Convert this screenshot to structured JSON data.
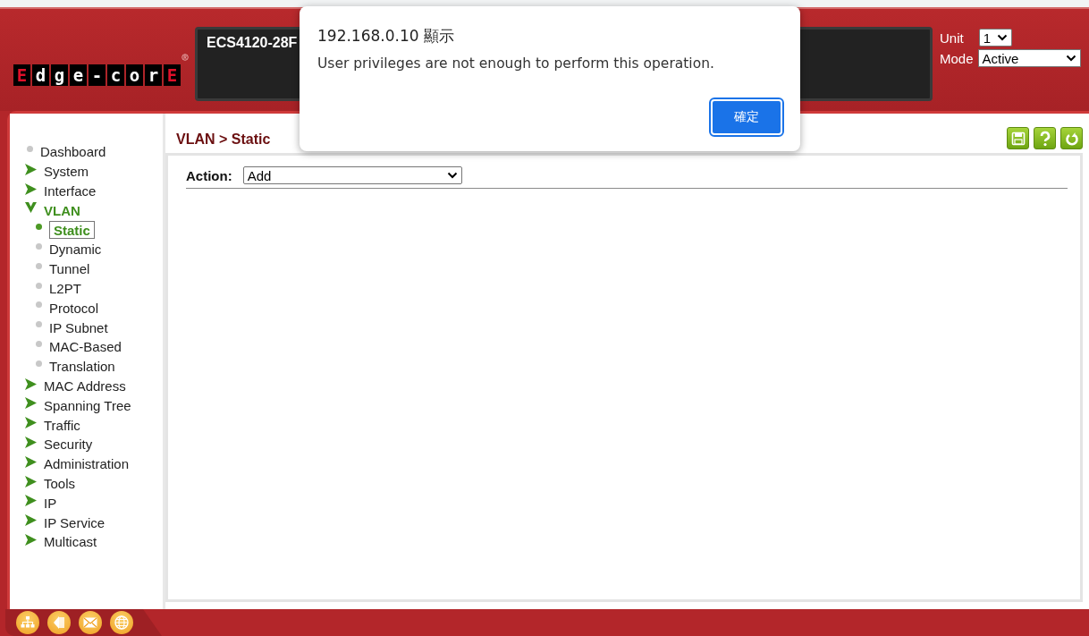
{
  "header": {
    "logo": [
      {
        "char": "E",
        "kind": "accent"
      },
      {
        "char": "d",
        "kind": "plain"
      },
      {
        "char": "g",
        "kind": "plain"
      },
      {
        "char": "e",
        "kind": "plain"
      },
      {
        "char": "-",
        "kind": "plain"
      },
      {
        "char": "c",
        "kind": "plain"
      },
      {
        "char": "o",
        "kind": "plain"
      },
      {
        "char": "r",
        "kind": "plain"
      },
      {
        "char": "E",
        "kind": "accent"
      }
    ],
    "model": "ECS4120-28F",
    "unit": {
      "label": "Unit",
      "value": "1"
    },
    "mode": {
      "label": "Mode",
      "value": "Active"
    }
  },
  "sidebar": {
    "items": [
      {
        "kind": "leaf",
        "label": "Dashboard",
        "selected": false
      },
      {
        "kind": "group",
        "label": "System",
        "expanded": false
      },
      {
        "kind": "group",
        "label": "Interface",
        "expanded": false
      },
      {
        "kind": "group",
        "label": "VLAN",
        "expanded": true,
        "children": [
          {
            "kind": "leaf",
            "label": "Static",
            "selected": true
          },
          {
            "kind": "leaf",
            "label": "Dynamic",
            "selected": false
          },
          {
            "kind": "leaf",
            "label": "Tunnel",
            "selected": false
          },
          {
            "kind": "leaf",
            "label": "L2PT",
            "selected": false
          },
          {
            "kind": "leaf",
            "label": "Protocol",
            "selected": false
          },
          {
            "kind": "leaf",
            "label": "IP Subnet",
            "selected": false
          },
          {
            "kind": "leaf",
            "label": "MAC-Based",
            "selected": false
          },
          {
            "kind": "leaf",
            "label": "Translation",
            "selected": false
          }
        ]
      },
      {
        "kind": "group",
        "label": "MAC Address",
        "expanded": false
      },
      {
        "kind": "group",
        "label": "Spanning Tree",
        "expanded": false
      },
      {
        "kind": "group",
        "label": "Traffic",
        "expanded": false
      },
      {
        "kind": "group",
        "label": "Security",
        "expanded": false
      },
      {
        "kind": "group",
        "label": "Administration",
        "expanded": false
      },
      {
        "kind": "group",
        "label": "Tools",
        "expanded": false
      },
      {
        "kind": "group",
        "label": "IP",
        "expanded": false
      },
      {
        "kind": "group",
        "label": "IP Service",
        "expanded": false
      },
      {
        "kind": "group",
        "label": "Multicast",
        "expanded": false
      }
    ]
  },
  "content": {
    "breadcrumb": "VLAN > Static",
    "action": {
      "label": "Action:",
      "value": "Add"
    }
  },
  "dialog": {
    "title": "192.168.0.10 顯示",
    "message": "User privileges are not enough to perform this operation.",
    "button": "確定"
  }
}
